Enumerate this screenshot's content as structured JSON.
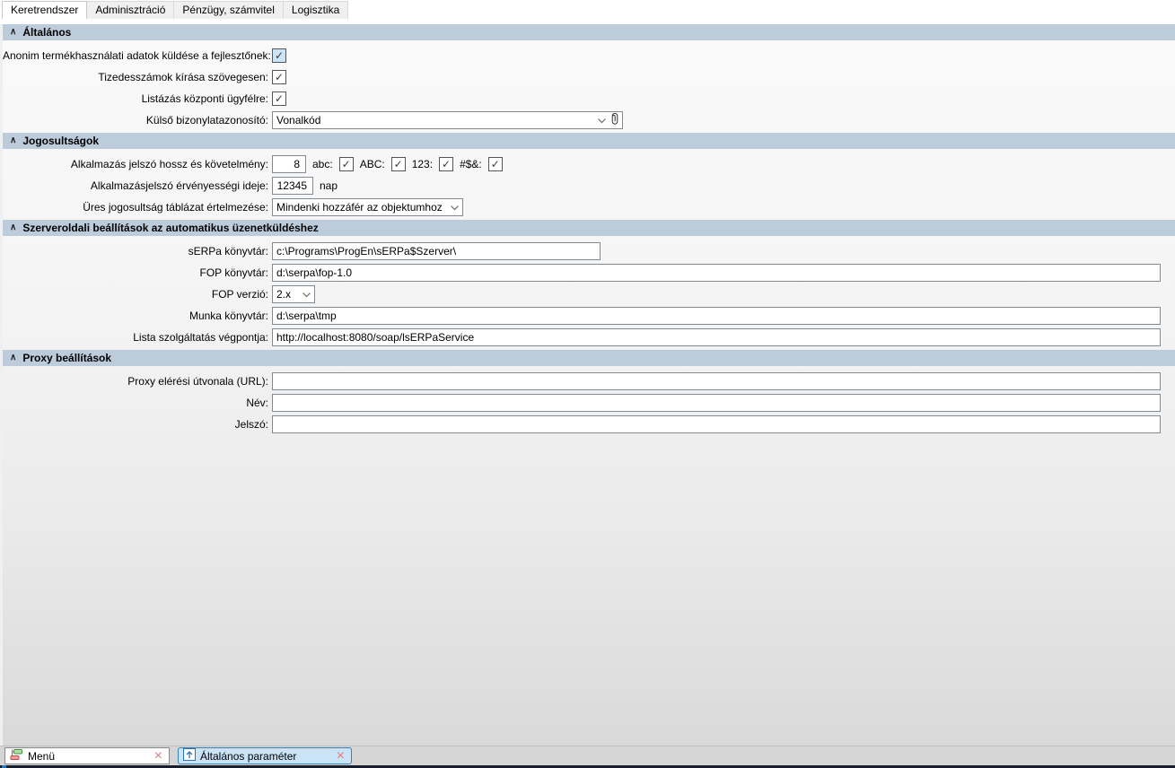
{
  "tabbar": {
    "tabs": [
      {
        "label": "Keretrendszer",
        "active": true
      },
      {
        "label": "Adminisztráció",
        "active": false
      },
      {
        "label": "Pénzügy, számvitel",
        "active": false
      },
      {
        "label": "Logisztika",
        "active": false
      }
    ]
  },
  "icons": {
    "check": "✓",
    "collapse": "∧",
    "close": "×"
  },
  "colors": {
    "section_header_bg": "#bdccdb",
    "focused_checkbox_bg": "#cce4f7",
    "active_task_tab_bg": "#cbe3f7",
    "active_task_tab_border": "#3c7fb1",
    "close_x": "#e07c7c"
  },
  "general": {
    "title": "Általános",
    "anonim_label": "Anonim termékhasználati adatok küldése a fejlesztőnek:",
    "tizedes_label": "Tizedesszámok kírása szövegesen:",
    "listazas_label": "Listázás központi ügyfélre:",
    "kulso_label": "Külső bizonylatazonosító:",
    "kulso_value": "Vonalkód"
  },
  "jogosultsagok": {
    "title": "Jogosultságok",
    "pw_req_label": "Alkalmazás jelszó hossz és követelmény:",
    "pw_length": "8",
    "abc_label": "abc:",
    "abc_upper_label": "ABC:",
    "num_label": "123:",
    "sym_label": "#$&:",
    "pw_valid_label": "Alkalmazásjelszó érvényességi ideje:",
    "pw_valid_value": "12345",
    "pw_valid_suffix": "nap",
    "empty_rights_label": "Üres jogosultság táblázat értelmezése:",
    "empty_rights_value": "Mindenki hozzáfér az objektumhoz"
  },
  "szerveroldali": {
    "title": "Szerveroldali beállítások az automatikus üzenetküldéshez",
    "serpa_dir_label": "sERPa könyvtár:",
    "serpa_dir_value": "c:\\Programs\\ProgEn\\sERPa$Szerver\\",
    "fop_dir_label": "FOP könyvtár:",
    "fop_dir_value": "d:\\serpa\\fop-1.0",
    "fop_ver_label": "FOP verzió:",
    "fop_ver_value": "2.x",
    "work_dir_label": "Munka könyvtár:",
    "work_dir_value": "d:\\serpa\\tmp",
    "endpoint_label": "Lista szolgáltatás végpontja:",
    "endpoint_value": "http://localhost:8080/soap/lsERPaService"
  },
  "proxy": {
    "title": "Proxy beállítások",
    "url_label": "Proxy elérési útvonala (URL):",
    "url_value": "",
    "name_label": "Név:",
    "name_value": "",
    "pass_label": "Jelszó:",
    "pass_value": ""
  },
  "taskbar": {
    "menu_label": "Menü",
    "param_label": "Általános paraméter"
  }
}
